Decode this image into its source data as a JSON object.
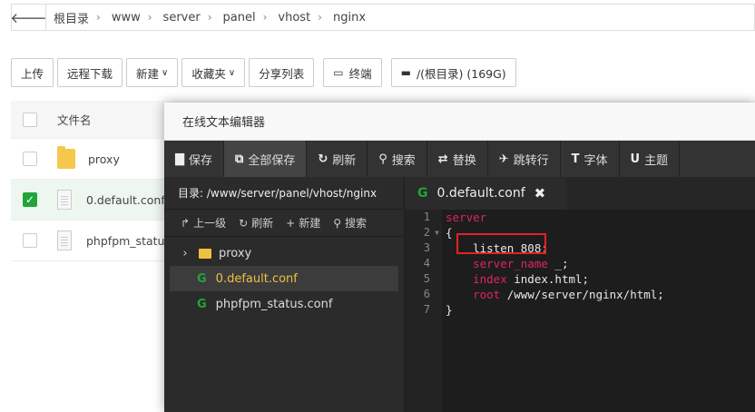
{
  "breadcrumb": [
    "根目录",
    "www",
    "server",
    "panel",
    "vhost",
    "nginx"
  ],
  "toolbar": [
    {
      "label": "上传"
    },
    {
      "label": "远程下载"
    },
    {
      "label": "新建",
      "caret": "∨"
    },
    {
      "label": "收藏夹",
      "caret": "∨"
    },
    {
      "label": "分享列表"
    },
    {
      "label": "终端",
      "icon": "terminal-icon"
    },
    {
      "label": "/(根目录) (169G)",
      "icon": "disk-icon"
    }
  ],
  "file_list": {
    "header": "文件名",
    "rows": [
      {
        "name": "proxy",
        "type": "folder",
        "selected": false
      },
      {
        "name": "0.default.conf",
        "type": "file",
        "selected": true
      },
      {
        "name": "phpfpm_status",
        "type": "file",
        "selected": false
      }
    ]
  },
  "editor": {
    "title": "在线文本编辑器",
    "tools": [
      {
        "label": "保存",
        "icon": "save-icon",
        "glyph": "▇"
      },
      {
        "label": "全部保存",
        "icon": "save-all-icon",
        "glyph": "⧉"
      },
      {
        "label": "刷新",
        "icon": "refresh-icon",
        "glyph": "↻"
      },
      {
        "label": "搜索",
        "icon": "search-icon",
        "glyph": "⚲"
      },
      {
        "label": "替换",
        "icon": "replace-icon",
        "glyph": "⇄"
      },
      {
        "label": "跳转行",
        "icon": "pin-icon",
        "glyph": "✈"
      },
      {
        "label": "字体",
        "icon": "font-icon",
        "glyph": "T"
      },
      {
        "label": "主题",
        "icon": "theme-icon",
        "glyph": "U"
      }
    ],
    "dir_label": "目录: /www/server/panel/vhost/nginx",
    "side_tools": [
      {
        "label": "上一级",
        "icon": "up-icon",
        "glyph": "↱"
      },
      {
        "label": "刷新",
        "icon": "refresh-icon",
        "glyph": "↻"
      },
      {
        "label": "新建",
        "icon": "plus-icon",
        "glyph": "+"
      },
      {
        "label": "搜索",
        "icon": "search-icon",
        "glyph": "⚲"
      }
    ],
    "tree": [
      {
        "name": "proxy",
        "type": "folder"
      },
      {
        "name": "0.default.conf",
        "type": "file",
        "active": true
      },
      {
        "name": "phpfpm_status.conf",
        "type": "file"
      }
    ],
    "tab": {
      "name": "0.default.conf"
    },
    "code": [
      {
        "n": "1",
        "kw": "server",
        "rest": ""
      },
      {
        "n": "2",
        "kw": "",
        "rest": "{",
        "fold": true
      },
      {
        "n": "3",
        "kw": "",
        "rest": "    listen 808;"
      },
      {
        "n": "4",
        "kw": "    server_name",
        "rest": " _;"
      },
      {
        "n": "5",
        "kw": "    index",
        "rest": " index.html;"
      },
      {
        "n": "6",
        "kw": "    root",
        "rest": " /www/server/nginx/html;"
      },
      {
        "n": "7",
        "kw": "",
        "rest": "}"
      }
    ],
    "highlight_color": "#e02424"
  },
  "colors": {
    "accent": "#20a53a",
    "folder": "#f5c84c",
    "keyword": "#e0245e"
  }
}
